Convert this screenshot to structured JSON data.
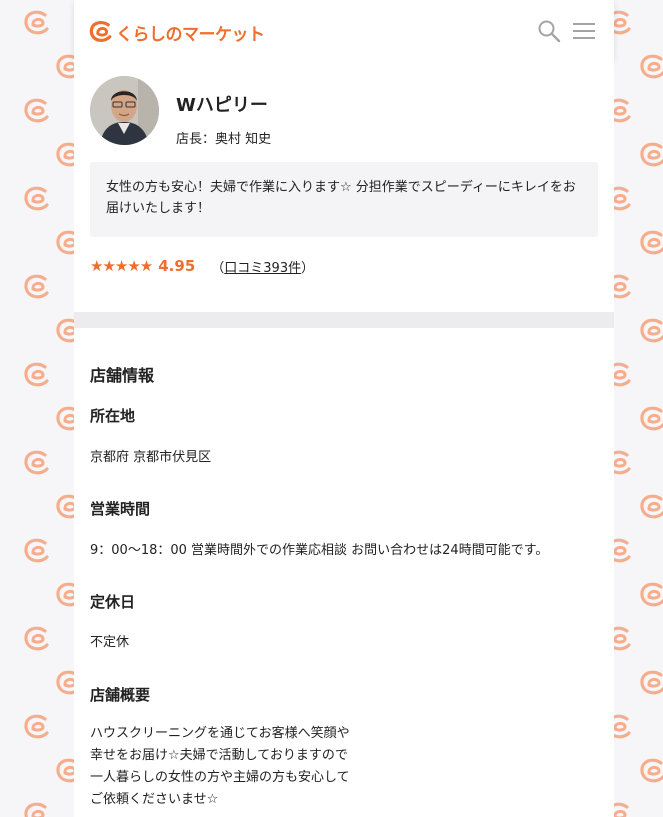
{
  "header": {
    "logo_text": "くらしのマーケット",
    "brand_color": "#ee6f2d"
  },
  "icons": {
    "search": "search-icon",
    "menu": "hamburger-menu-icon",
    "background": "kurashi-logo-mark-pattern"
  },
  "shop": {
    "name": "Wハピリー",
    "manager": "店長：奥村 知史",
    "message": "女性の方も安心！夫婦で作業に入ります☆ 分担作業でスピーディーにキレイをお届けいたします！",
    "stars": "★★★★★",
    "rating": "4.95",
    "review_open": "（",
    "review_link": "口コミ393件",
    "review_close": "）"
  },
  "info": {
    "title": "店舗情報",
    "location_label": "所在地",
    "location_value": "京都府 京都市伏見区",
    "hours_label": "営業時間",
    "hours_value": "9：00〜18：00 営業時間外での作業応相談 お問い合わせは24時間可能です。",
    "holiday_label": "定休日",
    "holiday_value": "不定休",
    "overview_label": "店舗概要",
    "overview_lines": [
      "ハウスクリーニングを通じてお客様へ笑顔や",
      "幸せをお届け☆夫婦で活動しておりますので",
      "一人暮らしの女性の方や主婦の方も安心して",
      "ご依頼くださいませ☆"
    ]
  }
}
